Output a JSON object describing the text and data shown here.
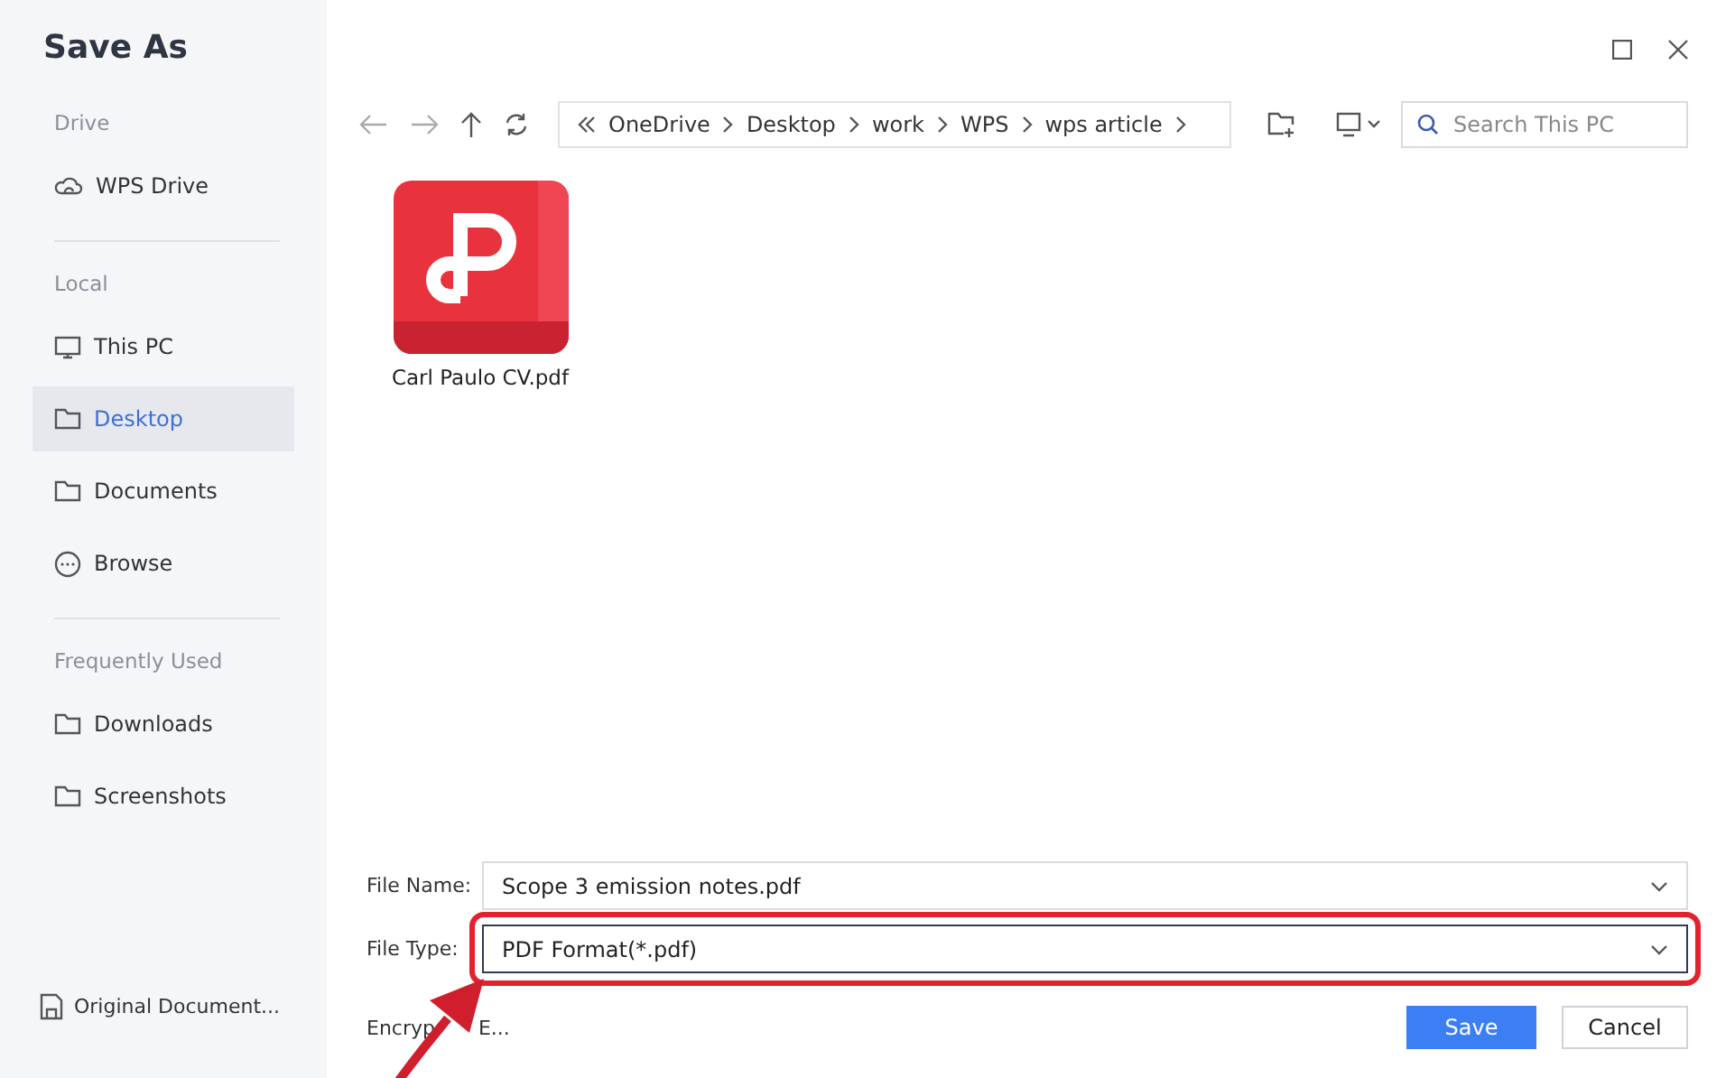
{
  "window": {
    "title": "Save As"
  },
  "sidebar": {
    "sections": [
      {
        "label": "Drive",
        "items": [
          {
            "kind": "cloud",
            "label": "WPS Drive",
            "selected": false
          }
        ]
      },
      {
        "label": "Local",
        "items": [
          {
            "kind": "monitor",
            "label": "This PC",
            "selected": false
          },
          {
            "kind": "folder",
            "label": "Desktop",
            "selected": true
          },
          {
            "kind": "folder",
            "label": "Documents",
            "selected": false
          },
          {
            "kind": "more",
            "label": "Browse",
            "selected": false
          }
        ]
      },
      {
        "label": "Frequently Used",
        "items": [
          {
            "kind": "folder",
            "label": "Downloads",
            "selected": false
          },
          {
            "kind": "folder",
            "label": "Screenshots",
            "selected": false
          }
        ]
      }
    ],
    "footer": "Original Document..."
  },
  "breadcrumb": [
    "OneDrive",
    "Desktop",
    "work",
    "WPS",
    "wps article"
  ],
  "search": {
    "placeholder": "Search This PC"
  },
  "files": [
    {
      "name": "Carl Paulo CV.pdf"
    }
  ],
  "form": {
    "file_name": {
      "label": "File Name:",
      "value": "Scope 3 emission notes.pdf",
      "highlighted": false
    },
    "file_type": {
      "label": "File Type:",
      "value": "PDF Format(*.pdf)",
      "highlighted": true
    },
    "encryption": [
      "Encryp",
      "E..."
    ]
  },
  "buttons": [
    {
      "label": "Save",
      "primary": true
    },
    {
      "label": "Cancel",
      "primary": false
    }
  ]
}
